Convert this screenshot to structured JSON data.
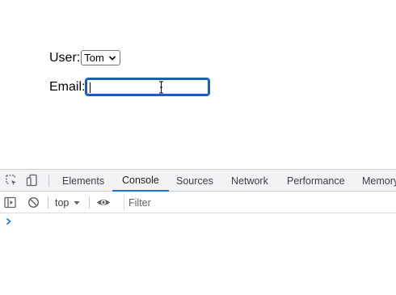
{
  "form": {
    "user_label": "User:",
    "user_selected": "Tom",
    "email_label": "Email:",
    "email_value": ""
  },
  "devtools": {
    "tabs": [
      "Elements",
      "Console",
      "Sources",
      "Network",
      "Performance",
      "Memory"
    ],
    "active_tab": "Console",
    "context": "top",
    "filter_placeholder": "Filter"
  },
  "colors": {
    "focus_ring": "#1a5fb4",
    "active_tab_underline": "#1a73e8",
    "prompt_chevron": "#1a73e8"
  }
}
